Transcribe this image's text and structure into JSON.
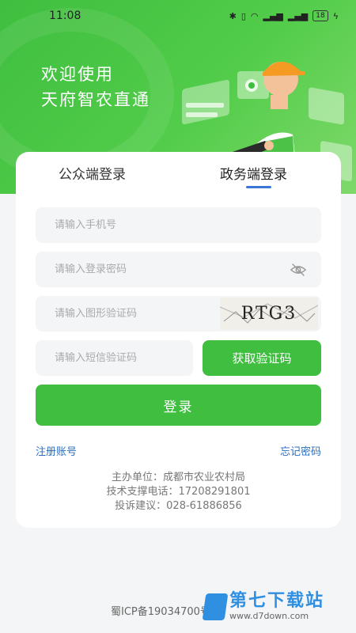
{
  "status_bar": {
    "time": "11:08",
    "battery": "18"
  },
  "hero": {
    "welcome_line1": "欢迎使用",
    "welcome_line2": "天府智农直通"
  },
  "tabs": [
    {
      "label": "公众端登录",
      "active": false
    },
    {
      "label": "政务端登录",
      "active": true
    }
  ],
  "form": {
    "phone_placeholder": "请输入手机号",
    "password_placeholder": "请输入登录密码",
    "captcha_placeholder": "请输入图形验证码",
    "captcha_text": "RTG3",
    "sms_placeholder": "请输入短信验证码",
    "sms_button": "获取验证码",
    "login_button": "登录"
  },
  "links": {
    "register": "注册账号",
    "forgot": "忘记密码"
  },
  "info": {
    "organizer": "主办单位：成都市农业农村局",
    "support": "技术支撑电话：17208291801",
    "complaint": "投诉建议：028-61886856"
  },
  "footer": {
    "icp": "蜀ICP备19034700号-6"
  },
  "watermark": {
    "name": "第七下载站",
    "url": "www.d7down.com"
  },
  "colors": {
    "primary": "#3fbe3f",
    "link": "#2a6fbf",
    "tab_indicator": "#3a76d6"
  }
}
